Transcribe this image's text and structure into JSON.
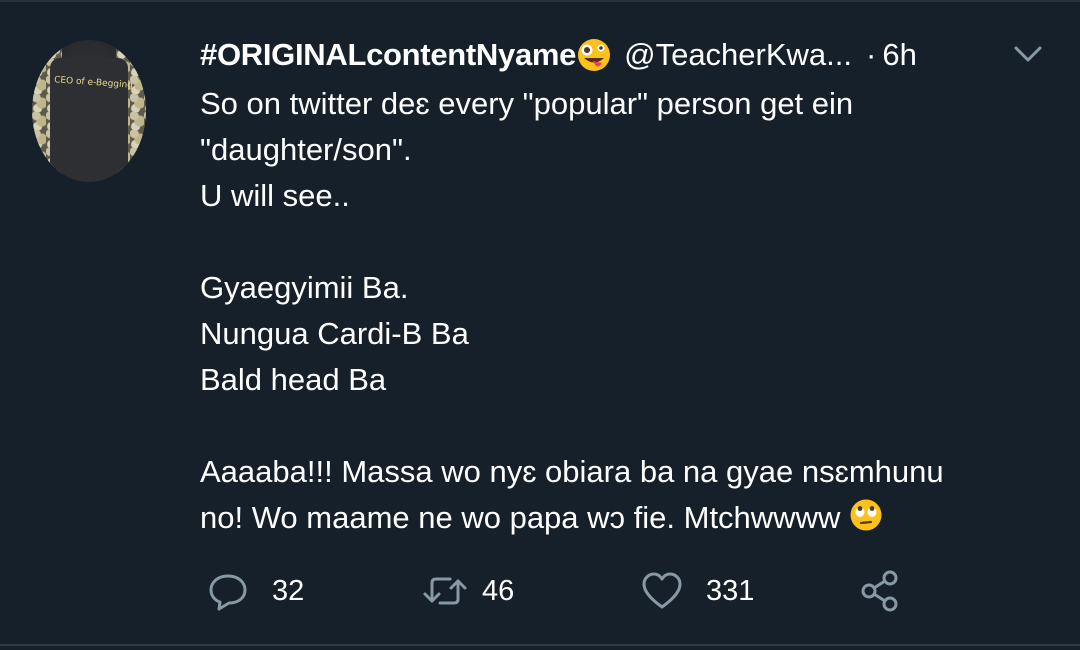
{
  "tweet": {
    "display_name": "#ORIGINALcontentNyame",
    "name_emoji": "zany-face",
    "handle": "@TeacherKwa...",
    "separator": "·",
    "time": "6h",
    "avatar_text": "CEO of e-Begging",
    "lines": [
      "So on twitter deɛ every \"popular\" person get ein",
      "\"daughter/son\".",
      "U will see..",
      "",
      "Gyaegyimii Ba.",
      "Nungua Cardi-B Ba",
      "Bald head Ba",
      "",
      "Aaaaba!!! Massa wo nyɛ obiara ba na gyae nsɛmhunu",
      "no! Wo maame ne wo papa wɔ fie. Mtchwwww"
    ],
    "end_emoji": "rolling-eyes-face"
  },
  "actions": {
    "reply_count": "32",
    "retweet_count": "46",
    "like_count": "331"
  },
  "colors": {
    "background": "#15202b",
    "text": "#ffffff",
    "icon": "#8899a6",
    "divider": "#2f3b47"
  }
}
